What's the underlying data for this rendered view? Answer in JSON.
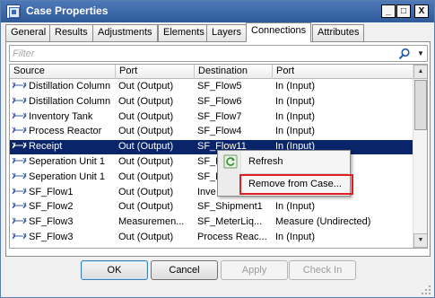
{
  "window": {
    "title": "Case Properties",
    "icon": "case-properties-icon"
  },
  "title_buttons": {
    "minimize": "_",
    "maximize": "□",
    "close": "X"
  },
  "tabs": [
    {
      "label": "General"
    },
    {
      "label": "Results"
    },
    {
      "label": "Adjustments"
    },
    {
      "label": "Elements"
    },
    {
      "label": "Layers"
    },
    {
      "label": "Connections",
      "active": true
    },
    {
      "label": "Attributes"
    }
  ],
  "filter": {
    "placeholder": "Filter",
    "icon": "search-icon",
    "dropdown": "▼"
  },
  "table": {
    "columns": [
      "Source",
      "Port",
      "Destination",
      "Port"
    ],
    "rows": [
      [
        "Distillation Column",
        "Out (Output)",
        "SF_Flow5",
        "In (Input)"
      ],
      [
        "Distillation Column",
        "Out (Output)",
        "SF_Flow6",
        "In (Input)"
      ],
      [
        "Inventory Tank",
        "Out (Output)",
        "SF_Flow7",
        "In (Input)"
      ],
      [
        "Process Reactor",
        "Out (Output)",
        "SF_Flow4",
        "In (Input)"
      ],
      [
        "Receipt",
        "Out (Output)",
        "SF_Flow11",
        "In (Input)"
      ],
      [
        "Seperation Unit 1",
        "Out (Output)",
        "SF_F",
        ""
      ],
      [
        "Seperation Unit 1",
        "Out (Output)",
        "SF_F",
        ""
      ],
      [
        "SF_Flow1",
        "Out (Output)",
        "Inve",
        ""
      ],
      [
        "SF_Flow2",
        "Out (Output)",
        "SF_Shipment1",
        "In (Input)"
      ],
      [
        "SF_Flow3",
        "Measuremen...",
        "SF_MeterLiq...",
        "Measure (Undirected)"
      ],
      [
        "SF_Flow3",
        "Out (Output)",
        "Process Reac...",
        "In (Input)"
      ]
    ],
    "selected_row": 4
  },
  "context_menu": {
    "items": [
      "Refresh",
      "Remove from Case..."
    ],
    "highlighted": "Remove from Case..."
  },
  "buttons": {
    "ok": "OK",
    "cancel": "Cancel",
    "apply": "Apply",
    "check_in": "Check In"
  },
  "colors": {
    "title_bar": "#2f5a9a",
    "selection": "#0a246a",
    "highlight_box": "#e02020"
  }
}
